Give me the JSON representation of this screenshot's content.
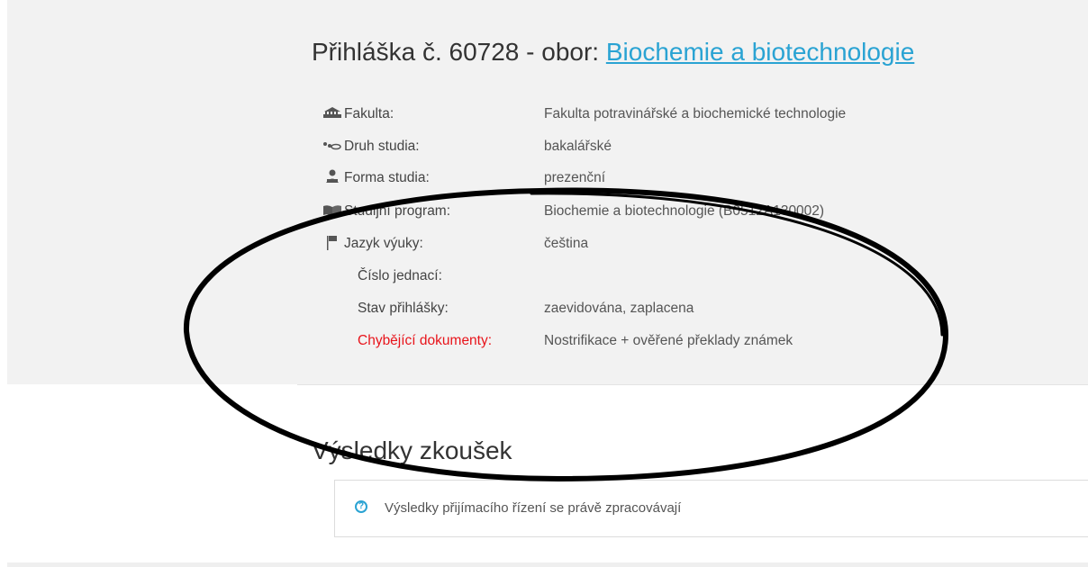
{
  "application": {
    "number_label": "Přihláška č. 60728 - obor: ",
    "field_link": "Biochemie a biotechnologie"
  },
  "details": [
    {
      "icon": "building-icon",
      "label": "Fakulta:",
      "value": "Fakulta potravinářské a biochemické technologie"
    },
    {
      "icon": "study-type-icon",
      "label": "Druh studia:",
      "value": "bakalářské"
    },
    {
      "icon": "person-icon",
      "label": "Forma studia:",
      "value": "prezenční"
    },
    {
      "icon": "book-icon",
      "label": "Studijní program:",
      "value": "Biochemie a biotechnologie (B0512A130002)"
    },
    {
      "icon": "flag-icon",
      "label": "Jazyk výuky:",
      "value": "čeština"
    },
    {
      "icon": null,
      "label": "Číslo jednací:",
      "value": ""
    },
    {
      "icon": null,
      "label": "Stav přihlášky:",
      "value": "zaevidována, zaplacena"
    },
    {
      "icon": null,
      "label": "Chybějící dokumenty:",
      "value": "Nostrifikace + ověřené překlady známek"
    }
  ],
  "results": {
    "title": "Výsledky zkoušek",
    "message": "Výsledky přijímacího řízení se právě zpracovávají"
  },
  "colors": {
    "link": "#2aa3d3",
    "missing_documents_label": "#e8141b",
    "panel_background": "#f2f2f2"
  }
}
